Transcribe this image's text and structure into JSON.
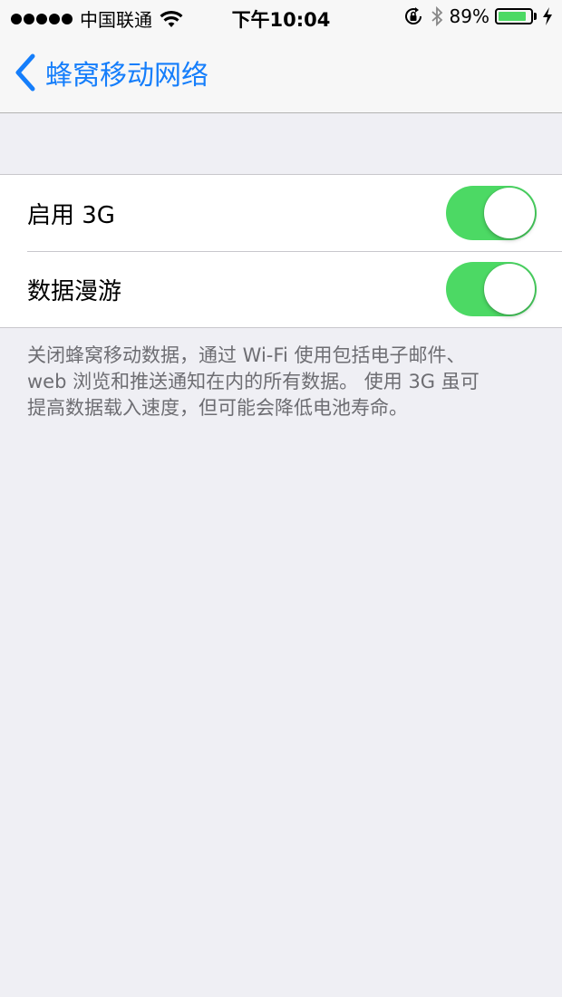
{
  "status_bar": {
    "carrier": "中国联通",
    "time": "下午10:04",
    "battery_percent": "89%",
    "battery_level": 0.89,
    "icons": [
      "signal-dots-icon",
      "wifi-icon",
      "orientation-lock-icon",
      "bluetooth-icon",
      "battery-icon",
      "charging-bolt-icon"
    ]
  },
  "nav": {
    "back_label": "蜂窝移动网络",
    "accent_color": "#157efb"
  },
  "settings": {
    "rows": [
      {
        "label": "启用 3G",
        "on": true
      },
      {
        "label": "数据漫游",
        "on": true
      }
    ],
    "toggle_on_color": "#4cd964"
  },
  "footer": {
    "line1": "关闭蜂窝移动数据，通过 Wi-Fi 使用包括电子邮件、",
    "line2": "web 浏览和推送通知在内的所有数据。 使用 3G 虽可",
    "line3": "提高数据载入速度，但可能会降低电池寿命。"
  }
}
